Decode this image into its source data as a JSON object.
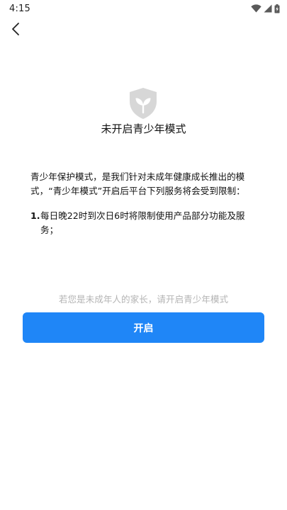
{
  "status_bar": {
    "time": "4:15",
    "icons": [
      "wifi-icon",
      "signal-icon",
      "battery-charging-icon"
    ]
  },
  "header": {
    "back_icon": "chevron-left-icon"
  },
  "main": {
    "shield_icon": "shield-leaf-icon",
    "title": "未开启青少年模式",
    "description_lines": [
      "青少年保护模式，是我们针对未成年健康成长推出的模",
      "式，“青少年模式”开启后平台下列服务将会受到限制："
    ],
    "rules": [
      {
        "number": "1.",
        "lines": [
          "每日晚22时到次日6时将限制使用产品部分功能及服",
          "务；"
        ]
      }
    ],
    "hint": "若您是未成年人的家长，请开启青少年模式",
    "open_button_label": "开启"
  },
  "colors": {
    "accent": "#1f86f7",
    "hint_text": "#b4b4b4",
    "shield": "#d7d7d7"
  }
}
